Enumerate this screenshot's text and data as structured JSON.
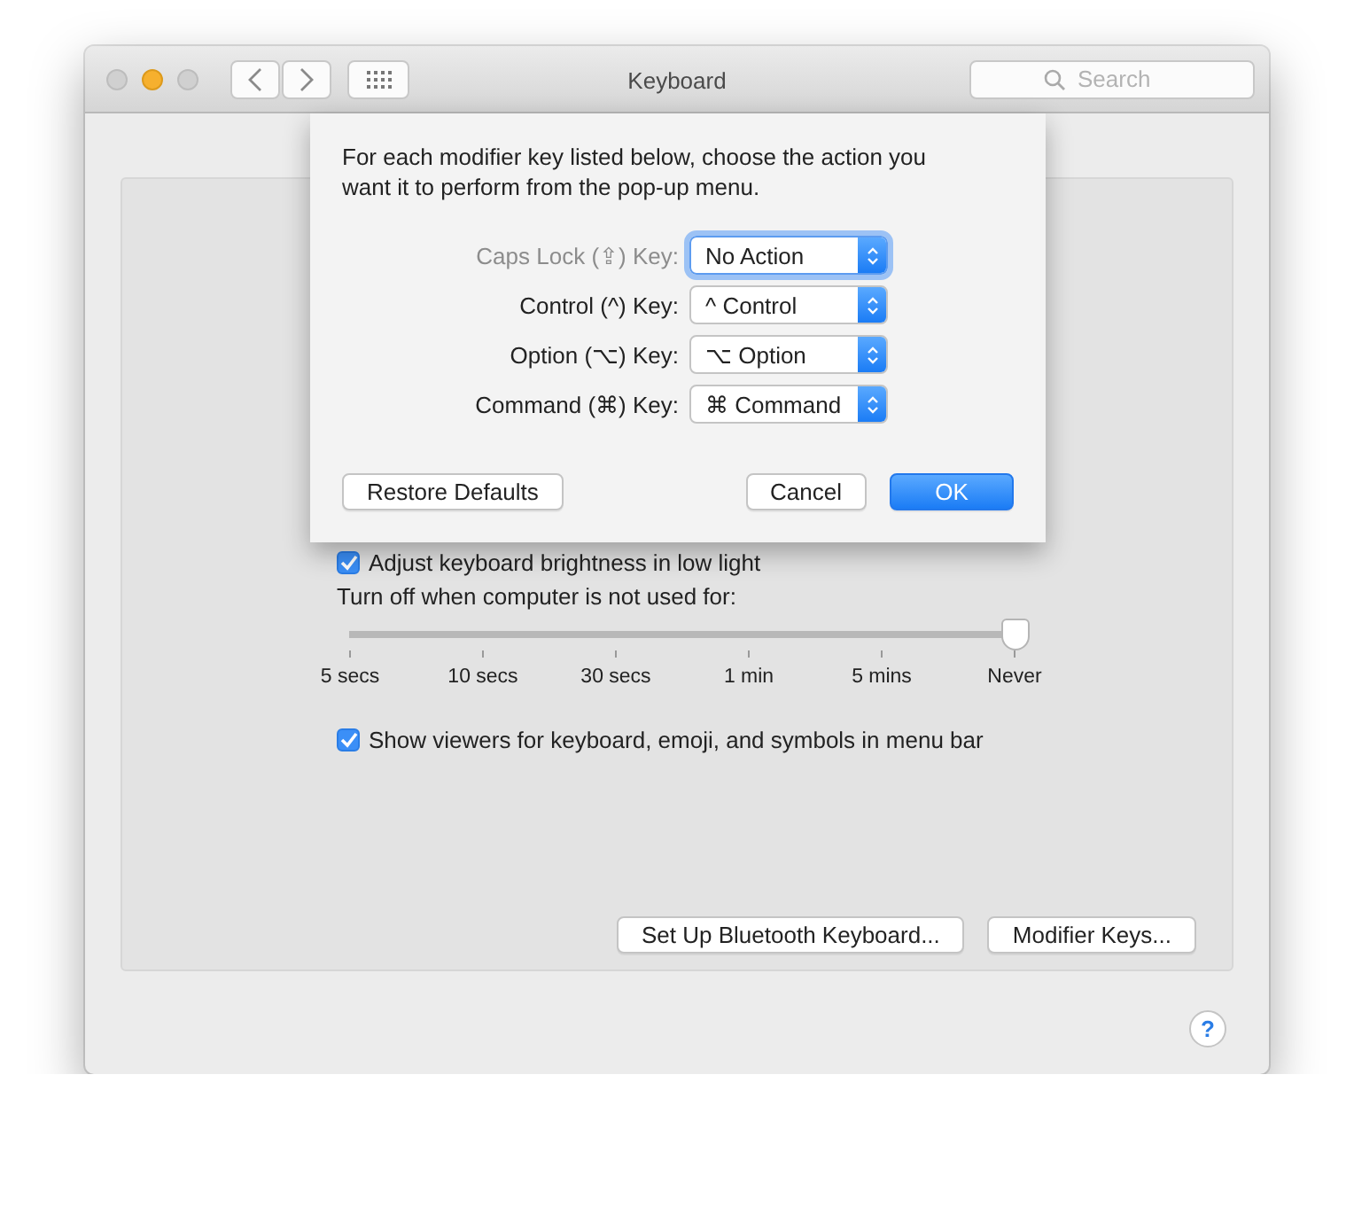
{
  "window": {
    "title": "Keyboard",
    "search": {
      "placeholder": "Search"
    }
  },
  "panel": {
    "brightness_checkbox": {
      "label": "Adjust keyboard brightness in low light",
      "checked": true
    },
    "turn_off_label": "Turn off when computer is not used for:",
    "slider": {
      "level": 1,
      "ticks": [
        "5 secs",
        "10 secs",
        "30 secs",
        "1 min",
        "5 mins",
        "Never"
      ]
    },
    "viewers_checkbox": {
      "label": "Show viewers for keyboard, emoji, and symbols in menu bar",
      "checked": true
    },
    "buttons": [
      "Set Up Bluetooth Keyboard...",
      "Modifier Keys..."
    ]
  },
  "help_button": "?",
  "sheet": {
    "message": "For each modifier key listed below, choose the action you want it to perform from the pop-up menu.",
    "rows": [
      {
        "label": "Caps Lock (⇪) Key:",
        "value": "No Action",
        "dimmed": true,
        "focused": true
      },
      {
        "label": "Control (^) Key:",
        "value": "^ Control",
        "dimmed": false,
        "focused": false
      },
      {
        "label": "Option (⌥) Key:",
        "value": "⌥ Option",
        "dimmed": false,
        "focused": false
      },
      {
        "label": "Command (⌘) Key:",
        "value": "⌘ Command",
        "dimmed": false,
        "focused": false
      }
    ],
    "restore_button": "Restore Defaults",
    "cancel_button": "Cancel",
    "ok_button": "OK"
  }
}
